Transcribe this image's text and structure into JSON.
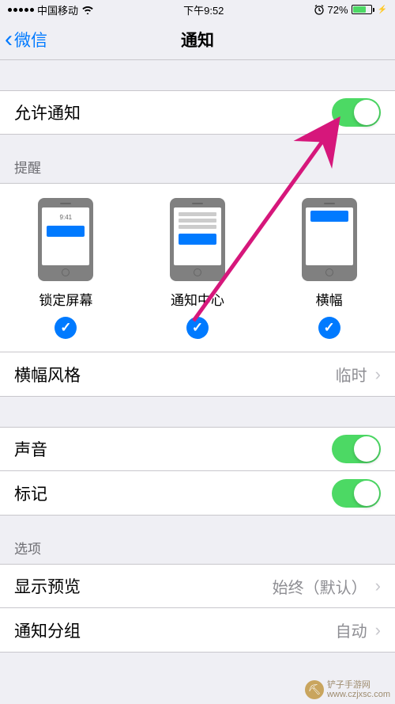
{
  "statusBar": {
    "carrier": "中国移动",
    "time": "下午9:52",
    "batteryPct": "72%"
  },
  "nav": {
    "backLabel": "微信",
    "title": "通知"
  },
  "allowNotifications": {
    "label": "允许通知"
  },
  "alertsHeader": "提醒",
  "alerts": {
    "lockScreen": {
      "label": "锁定屏幕",
      "lockTime": "9:41"
    },
    "notificationCenter": {
      "label": "通知中心"
    },
    "banners": {
      "label": "横幅"
    }
  },
  "bannerStyle": {
    "label": "横幅风格",
    "value": "临时"
  },
  "sounds": {
    "label": "声音"
  },
  "badges": {
    "label": "标记"
  },
  "optionsHeader": "选项",
  "showPreviews": {
    "label": "显示预览",
    "value": "始终（默认）"
  },
  "grouping": {
    "label": "通知分组",
    "value": "自动"
  },
  "watermark": {
    "name": "铲子手游网",
    "url": "www.czjxsc.com"
  }
}
